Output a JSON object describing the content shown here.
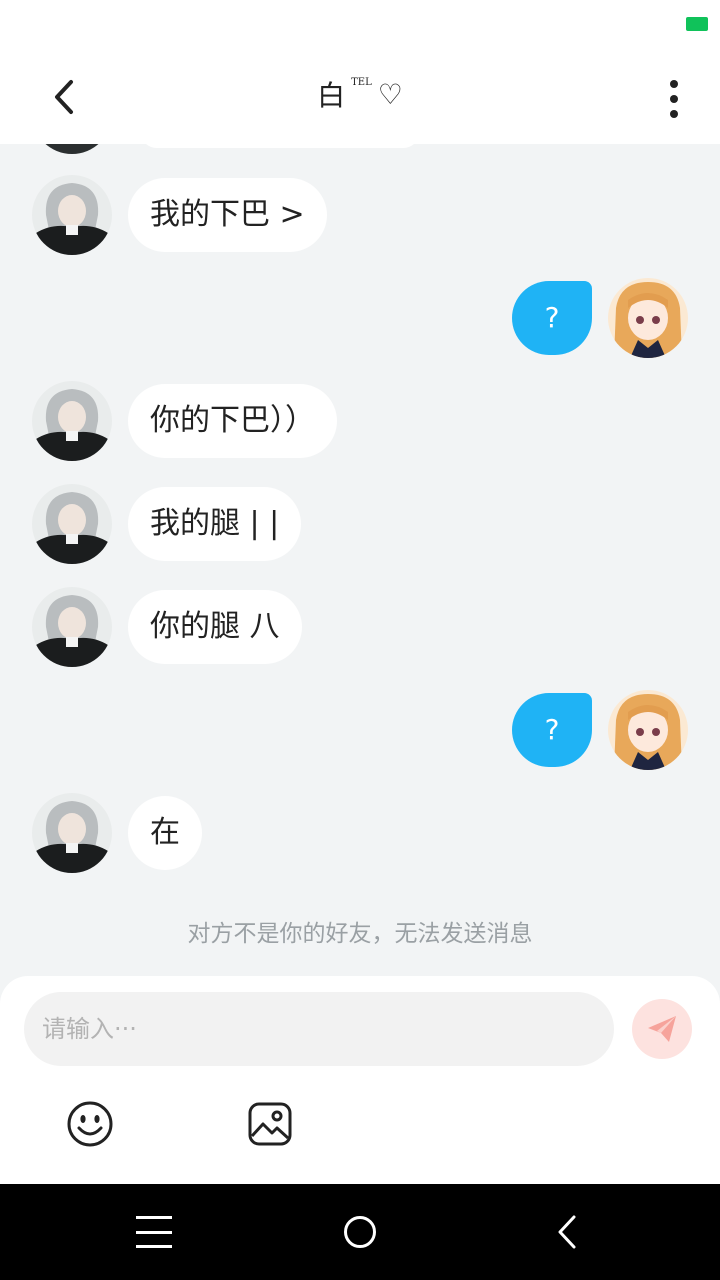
{
  "header": {
    "title": "白",
    "title_sup": "TEL",
    "heart_glyph": "♡"
  },
  "messages": [
    {
      "side": "left",
      "text": "我的下巴 >"
    },
    {
      "side": "right",
      "text": "?"
    },
    {
      "side": "left",
      "text": "你的下巴））"
    },
    {
      "side": "left",
      "text": "我的腿 | |"
    },
    {
      "side": "left",
      "text": "你的腿 八"
    },
    {
      "side": "right",
      "text": "?"
    },
    {
      "side": "left",
      "text": "在"
    }
  ],
  "notice": "对方不是你的好友，无法发送消息",
  "composer": {
    "placeholder": "请输入···"
  },
  "icons": {
    "back": "chevron-left-icon",
    "more": "more-vertical-icon",
    "send": "paper-plane-icon",
    "emoji": "smiley-icon",
    "image": "image-icon"
  },
  "colors": {
    "my_bubble": "#1fb3f5",
    "background": "#f2f4f5",
    "send_bg": "#fde2df",
    "send_icon": "#f6a39b"
  }
}
